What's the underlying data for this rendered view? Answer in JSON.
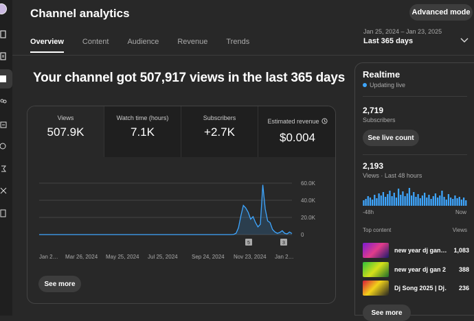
{
  "header": {
    "title": "Channel analytics",
    "advanced_label": "Advanced mode",
    "date_range": "Jan 25, 2024 – Jan 23, 2025",
    "period": "Last 365 days"
  },
  "tabs": [
    {
      "label": "Overview"
    },
    {
      "label": "Content"
    },
    {
      "label": "Audience"
    },
    {
      "label": "Revenue"
    },
    {
      "label": "Trends"
    }
  ],
  "headline": "Your channel got 507,917 views in the last 365 days",
  "metrics": [
    {
      "label": "Views",
      "value": "507.9K"
    },
    {
      "label": "Watch time (hours)",
      "value": "7.1K"
    },
    {
      "label": "Subscribers",
      "value": "+2.7K"
    },
    {
      "label": "Estimated revenue",
      "value": "$0.004"
    }
  ],
  "chart_data": {
    "type": "line",
    "x_tick_labels": [
      "Jan 2…",
      "Mar 26, 2024",
      "May 25, 2024",
      "Jul 25, 2024",
      "Sep 24, 2024",
      "Nov 23, 2024",
      "Jan 2…"
    ],
    "y_tick_labels": [
      "60.0K",
      "40.0K",
      "20.0K",
      "0"
    ],
    "ylim": [
      0,
      60000
    ],
    "series": [
      {
        "values": [
          0,
          0,
          0,
          0,
          0,
          0,
          0,
          0,
          0,
          0,
          0,
          0,
          0,
          0,
          0,
          0,
          0,
          0,
          0,
          0,
          0,
          0,
          0,
          0,
          0,
          0,
          0,
          0,
          0,
          0,
          0,
          0,
          0,
          0,
          0,
          0,
          0,
          0,
          0,
          0,
          0,
          0,
          0,
          0,
          0,
          0,
          0,
          0,
          0,
          0,
          0,
          0,
          0,
          0,
          0,
          0,
          0,
          0,
          0,
          0,
          0,
          0,
          0,
          0,
          0,
          0,
          0,
          0,
          0,
          0,
          0,
          0,
          0,
          0,
          0,
          0,
          0,
          0,
          0,
          0,
          200,
          1500,
          8000,
          22000,
          34000,
          31000,
          26000,
          18000,
          21000,
          14000,
          9000,
          12000,
          58000,
          30000,
          16000,
          14000,
          6000,
          3000,
          1500,
          2500,
          4500,
          1500,
          800,
          3000,
          1200
        ]
      }
    ],
    "markers": [
      "5",
      "3"
    ],
    "color": "#3ea6ff"
  },
  "see_more": "See more",
  "realtime": {
    "title": "Realtime",
    "status": "Updating live",
    "subs_value": "2,719",
    "subs_label": "Subscribers",
    "live_label": "See live count",
    "views_value": "2,193",
    "views_label": "Views · Last 48 hours",
    "bars": [
      8,
      10,
      14,
      12,
      9,
      16,
      11,
      18,
      15,
      20,
      13,
      17,
      22,
      14,
      19,
      12,
      25,
      16,
      21,
      14,
      18,
      26,
      15,
      20,
      13,
      17,
      11,
      15,
      19,
      12,
      16,
      10,
      14,
      18,
      12,
      15,
      22,
      13,
      9,
      17,
      12,
      10,
      15,
      11,
      13,
      9,
      12,
      8
    ],
    "axis_left": "-48h",
    "axis_right": "Now",
    "top_label": "Top content",
    "views_col": "Views",
    "items": [
      {
        "title": "new year dj gan…",
        "views": "1,083"
      },
      {
        "title": "new year dj gan 2…",
        "views": "388"
      },
      {
        "title": "Dj Song 2025 | Dj…",
        "views": "236"
      }
    ],
    "see_more": "See more"
  },
  "colors": {
    "accent": "#3ea6ff",
    "bg": "#282828",
    "panel": "#1f1f1f"
  }
}
